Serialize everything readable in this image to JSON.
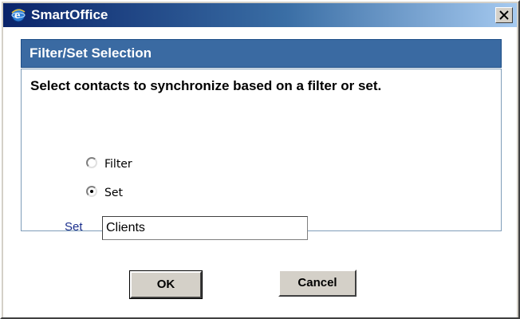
{
  "window": {
    "title": "SmartOffice",
    "app_icon": "ie-globe-icon",
    "close_icon": "close-icon"
  },
  "section": {
    "header": "Filter/Set Selection",
    "prompt": "Select contacts to synchronize based on a filter or set."
  },
  "options": [
    {
      "label": "Filter",
      "checked": false
    },
    {
      "label": "Set",
      "checked": true
    }
  ],
  "set_field": {
    "label": "Set",
    "value": "Clients"
  },
  "buttons": {
    "ok": "OK",
    "cancel": "Cancel"
  },
  "colors": {
    "title_bar_start": "#0a246a",
    "title_bar_end": "#a6caf0",
    "section_header": "#3a6aa2",
    "set_label": "#1a2e8c"
  }
}
